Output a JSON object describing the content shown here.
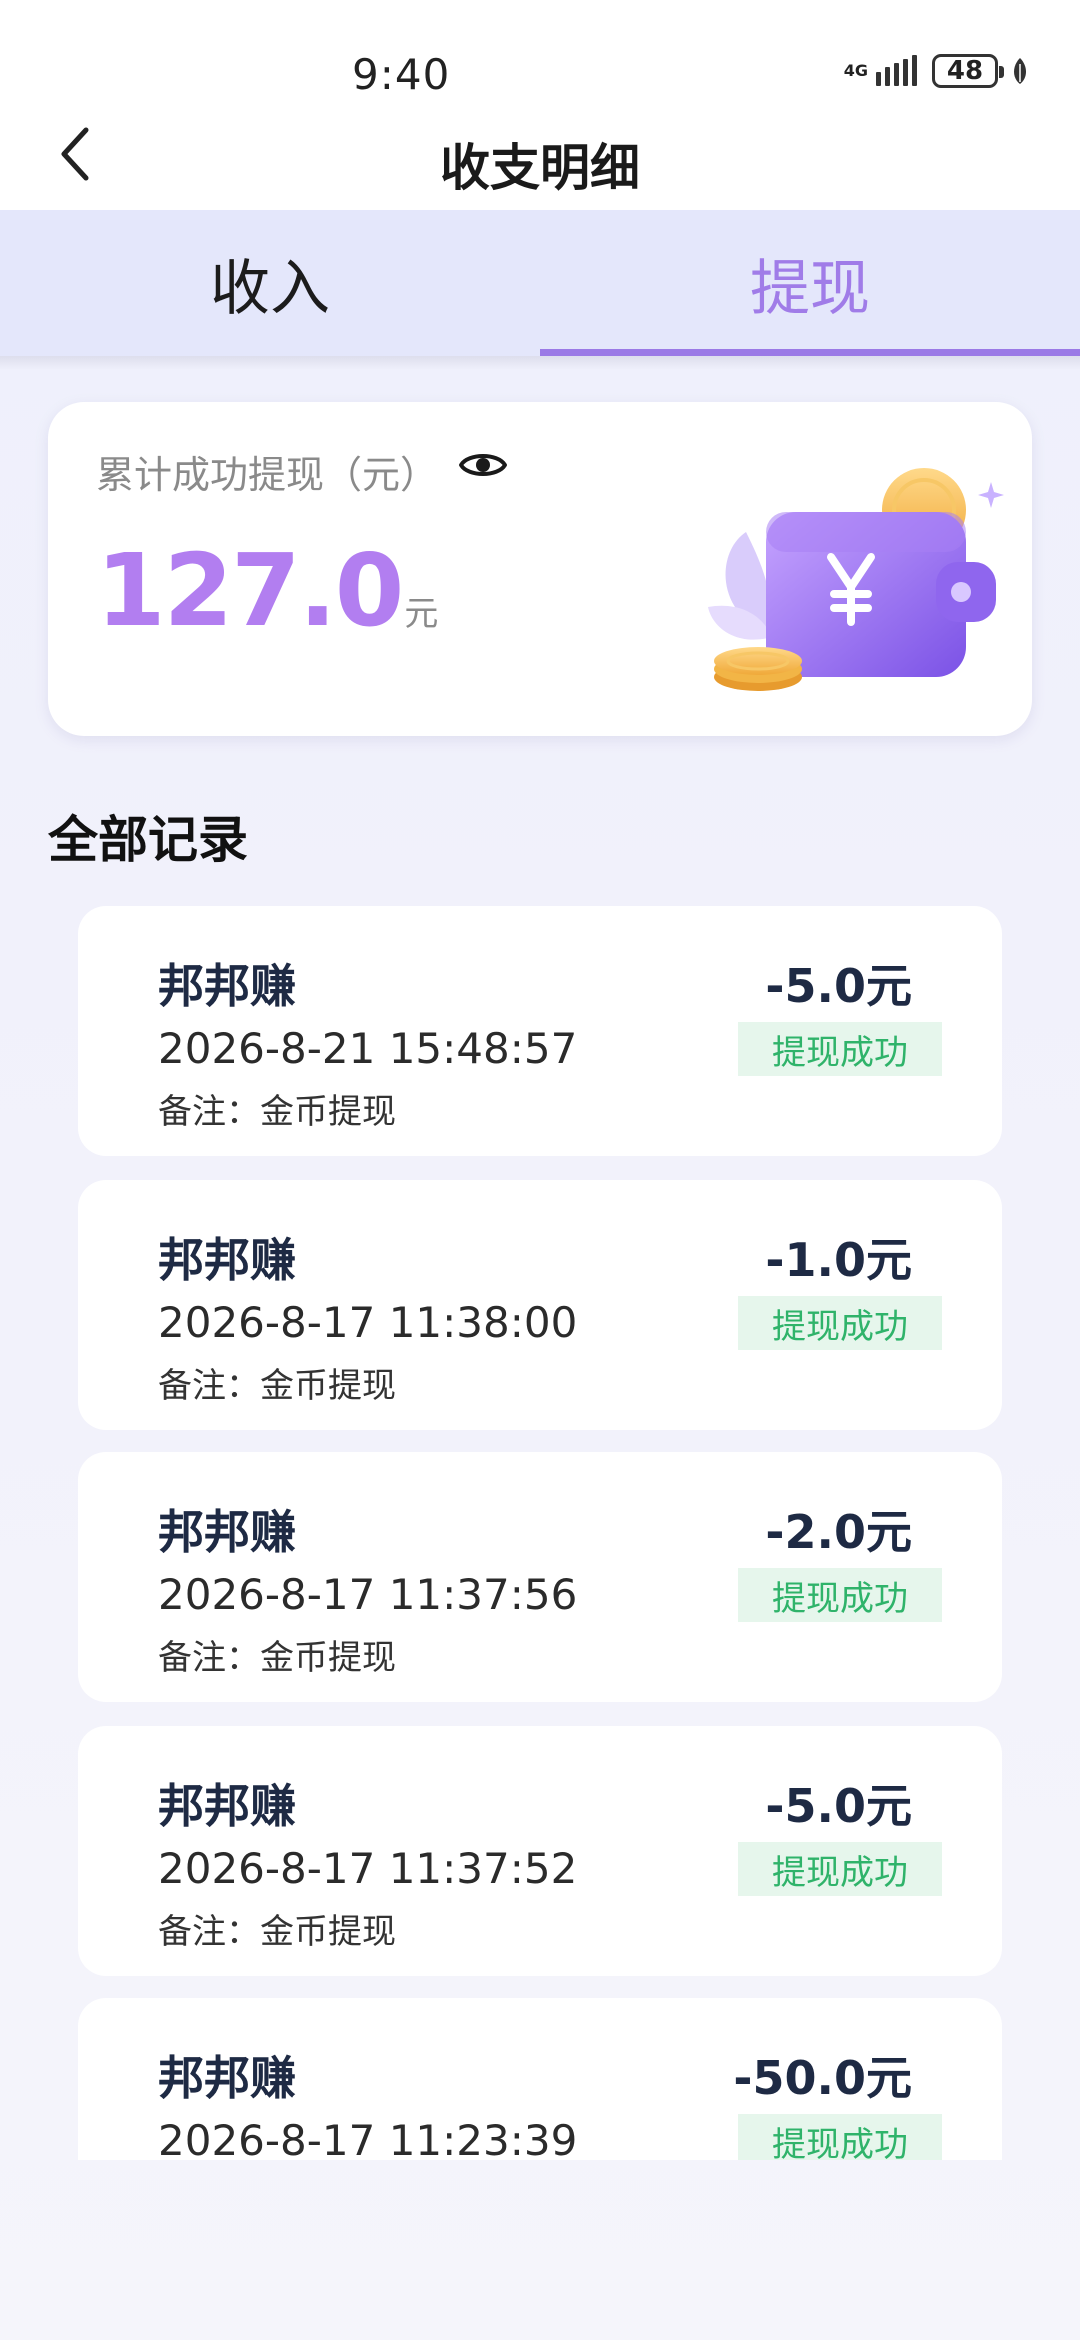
{
  "status_bar": {
    "time": "9:40",
    "network": "4G",
    "battery": "48"
  },
  "header": {
    "title": "收支明细"
  },
  "tabs": [
    {
      "label": "收入",
      "active": false
    },
    {
      "label": "提现",
      "active": true
    }
  ],
  "summary": {
    "label": "累计成功提现（元）",
    "amount": "127.0",
    "unit": "元"
  },
  "section_title": "全部记录",
  "records": [
    {
      "name": "邦邦赚",
      "time": "2026-8-21 15:48:57",
      "note": "备注：金币提现",
      "amount": "-5.0元",
      "status": "提现成功"
    },
    {
      "name": "邦邦赚",
      "time": "2026-8-17 11:38:00",
      "note": "备注：金币提现",
      "amount": "-1.0元",
      "status": "提现成功"
    },
    {
      "name": "邦邦赚",
      "time": "2026-8-17 11:37:56",
      "note": "备注：金币提现",
      "amount": "-2.0元",
      "status": "提现成功"
    },
    {
      "name": "邦邦赚",
      "time": "2026-8-17 11:37:52",
      "note": "备注：金币提现",
      "amount": "-5.0元",
      "status": "提现成功"
    },
    {
      "name": "邦邦赚",
      "time": "2026-8-17 11:23:39",
      "note": "",
      "amount": "-50.0元",
      "status": "提现成功"
    }
  ],
  "colors": {
    "accent": "#a07ce8",
    "amount": "#b27ef0",
    "success": "#2fb36a",
    "success_bg": "#e6f6ec"
  }
}
